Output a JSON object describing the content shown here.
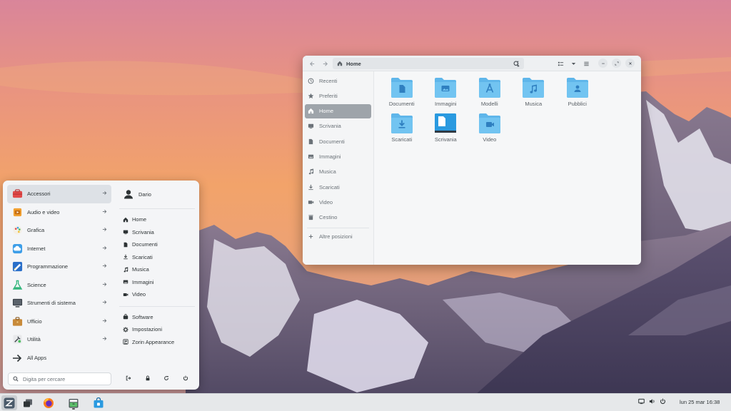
{
  "file_manager": {
    "pathbar": {
      "location": "Home"
    },
    "sidebar": [
      {
        "label": "Recenti",
        "icon": "clock-icon",
        "active": false
      },
      {
        "label": "Preferiti",
        "icon": "star-icon",
        "active": false
      },
      {
        "label": "Home",
        "icon": "home-icon",
        "active": true
      },
      {
        "label": "Scrivania",
        "icon": "desktop-icon",
        "active": false
      },
      {
        "label": "Documenti",
        "icon": "document-icon",
        "active": false
      },
      {
        "label": "Immagini",
        "icon": "image-icon",
        "active": false
      },
      {
        "label": "Musica",
        "icon": "music-icon",
        "active": false
      },
      {
        "label": "Scaricati",
        "icon": "download-icon",
        "active": false
      },
      {
        "label": "Video",
        "icon": "video-icon",
        "active": false
      },
      {
        "label": "Cestino",
        "icon": "trash-icon",
        "active": false
      },
      {
        "label": "Altre posizioni",
        "icon": "plus-icon",
        "active": false
      }
    ],
    "files": [
      {
        "name": "Documenti",
        "icon": "folder-documents-icon"
      },
      {
        "name": "Immagini",
        "icon": "folder-pictures-icon"
      },
      {
        "name": "Modelli",
        "icon": "folder-templates-icon"
      },
      {
        "name": "Musica",
        "icon": "folder-music-icon"
      },
      {
        "name": "Pubblici",
        "icon": "folder-public-icon"
      },
      {
        "name": "Scaricati",
        "icon": "folder-download-icon"
      },
      {
        "name": "Scrivania",
        "icon": "folder-desktop-icon"
      },
      {
        "name": "Video",
        "icon": "folder-video-icon"
      }
    ]
  },
  "menu": {
    "categories": [
      {
        "label": "Accessori",
        "icon": "accessories-icon",
        "active": true
      },
      {
        "label": "Audio e video",
        "icon": "multimedia-icon",
        "active": false
      },
      {
        "label": "Grafica",
        "icon": "graphics-icon",
        "active": false
      },
      {
        "label": "Internet",
        "icon": "internet-icon",
        "active": false
      },
      {
        "label": "Programmazione",
        "icon": "development-icon",
        "active": false
      },
      {
        "label": "Science",
        "icon": "science-icon",
        "active": false
      },
      {
        "label": "Strumenti di sistema",
        "icon": "system-tools-icon",
        "active": false
      },
      {
        "label": "Ufficio",
        "icon": "office-icon",
        "active": false
      },
      {
        "label": "Utilità",
        "icon": "utilities-icon",
        "active": false
      }
    ],
    "all_apps": "All Apps",
    "search_placeholder": "Digita per cercare",
    "user": "Dario",
    "places": [
      {
        "label": "Home",
        "icon": "home-icon"
      },
      {
        "label": "Scrivania",
        "icon": "desktop-icon"
      },
      {
        "label": "Documenti",
        "icon": "document-icon"
      },
      {
        "label": "Scaricati",
        "icon": "download-icon"
      },
      {
        "label": "Musica",
        "icon": "music-icon"
      },
      {
        "label": "Immagini",
        "icon": "image-icon"
      },
      {
        "label": "Video",
        "icon": "video-icon"
      }
    ],
    "system": [
      {
        "label": "Software",
        "icon": "software-icon"
      },
      {
        "label": "Impostazioni",
        "icon": "settings-icon"
      },
      {
        "label": "Zorin Appearance",
        "icon": "appearance-icon"
      }
    ],
    "power_buttons": [
      "logout-icon",
      "lock-icon",
      "restart-icon",
      "power-icon"
    ]
  },
  "taskbar": {
    "apps": [
      "zorin-menu-icon",
      "workspaces-icon",
      "firefox-icon",
      "files-icon",
      "software-store-icon"
    ],
    "tray": [
      "display-icon",
      "volume-icon",
      "power-icon"
    ],
    "clock": "lun 25 mar  16:38"
  },
  "colors": {
    "accent": "#4fa7e8",
    "folder": "#6ec3f0",
    "sidebar_active": "#9ea4aa"
  }
}
